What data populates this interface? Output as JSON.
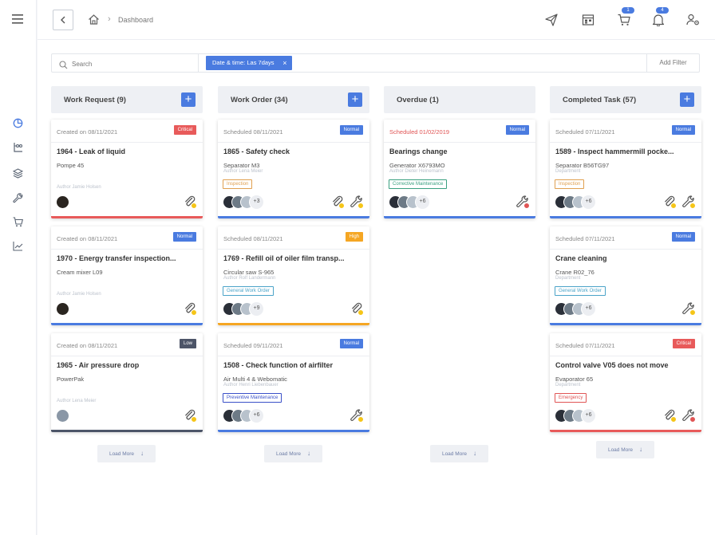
{
  "breadcrumb": {
    "page": "Dashboard"
  },
  "header": {
    "cart_badge": "1",
    "bell_badge": "4"
  },
  "filter": {
    "search_placeholder": "Search",
    "chip": "Date & time: Las 7days",
    "chip_close": "×",
    "add_filter": "Add Filter"
  },
  "load_more": "Load More",
  "colors": {
    "accent": "#4a7be0",
    "critical": "#e85a5a",
    "high": "#f5a623",
    "normal": "#4a7be0",
    "low": "#4d5568"
  },
  "columns": [
    {
      "title": "Work Request (9)",
      "cards": [
        {
          "date": "Created on 08/11/2021",
          "priority": "Critical",
          "title": "1964 - Leak of liquid",
          "sub": "Pompe 45",
          "author": "Author Jamie Holsen",
          "tag": "",
          "more": ""
        },
        {
          "date": "Created on 08/11/2021",
          "priority": "Normal",
          "title": "1970 - Energy transfer inspection...",
          "sub": "Cream mixer L09",
          "author": "Author Jamie Holsen",
          "tag": "",
          "more": ""
        },
        {
          "date": "Created on 08/11/2021",
          "priority": "Low",
          "title": "1965 - Air pressure drop",
          "sub": "PowerPak",
          "author": "Author Lena Meier",
          "tag": "",
          "more": ""
        }
      ]
    },
    {
      "title": "Work Order (34)",
      "cards": [
        {
          "date": "Scheduled 08/11/2021",
          "priority": "Normal",
          "title": "1865 - Safety check",
          "sub": "Separator M3",
          "author": "Author Lena Meier",
          "tag": "Inspection",
          "more": "+3"
        },
        {
          "date": "Scheduled 08/11/2021",
          "priority": "High",
          "title": "1769 - Refill oil of oiler film transp...",
          "sub": "Circular saw S-965",
          "author": "Author Rolf Landermann",
          "tag": "General Work Order",
          "more": "+9"
        },
        {
          "date": "Scheduled 09/11/2021",
          "priority": "Normal",
          "title": "1508 - Check function of airfilter",
          "sub": "Air Multi 4 & Webomatic",
          "author": "Author Henri Liebenbauer",
          "tag": "Preventive Maintenance",
          "more": "+6"
        }
      ]
    },
    {
      "title": "Overdue (1)",
      "cards": [
        {
          "date": "Scheduled 01/02/2019",
          "priority": "Normal",
          "title": "Bearings change",
          "sub": "Generator X6793MO",
          "author": "Author Dieter Heinemann",
          "tag": "Corrective Maintenance",
          "more": "+6"
        }
      ]
    },
    {
      "title": "Completed Task  (57)",
      "cards": [
        {
          "date": "Scheduled 07/11/2021",
          "priority": "Normal",
          "title": "1589 - Inspect hammermill pocke...",
          "sub": "Separator B56TG97",
          "author": "Department",
          "tag": "Inspection",
          "more": "+6"
        },
        {
          "date": "Scheduled 07/11/2021",
          "priority": "Normal",
          "title": "Crane cleaning",
          "sub": "Crane R02_76",
          "author": "Department",
          "tag": "General Work Order",
          "more": "+6"
        },
        {
          "date": "Scheduled 07/11/2021",
          "priority": "Critical",
          "title": "Control valve V05 does not move",
          "sub": "Evaporator 65",
          "author": "Department",
          "tag": "Emergency",
          "more": "+6"
        }
      ]
    }
  ]
}
